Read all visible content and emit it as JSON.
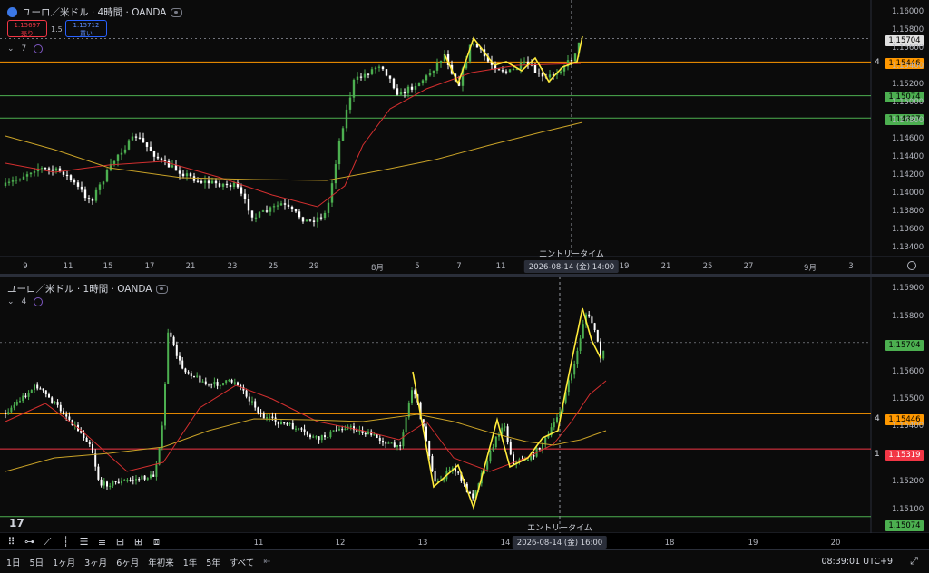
{
  "top": {
    "title": "ユーロ／米ドル · 4時間 · OANDA",
    "sell_price": "1.15697",
    "sell_label": "売り",
    "spread": "1.5",
    "buy_price": "1.15712",
    "buy_label": "買い",
    "indicator_count": "7",
    "price_axis": [
      "1.16000",
      "1.15800",
      "1.15600",
      "1.15400",
      "1.15200",
      "1.15000",
      "1.14800",
      "1.14600",
      "1.14400",
      "1.14200",
      "1.14000",
      "1.13800",
      "1.13600",
      "1.13400"
    ],
    "time_axis": [
      "9",
      "11",
      "15",
      "17",
      "21",
      "23",
      "25",
      "29",
      "8月",
      "5",
      "7",
      "11",
      "19",
      "21",
      "25",
      "27",
      "9月",
      "3"
    ],
    "crosshair_time": "2026-08-14 (金)  14:00",
    "entry_label": "エントリータイム",
    "tags": {
      "last": "1.15704",
      "orange": "1.15446",
      "green1": "1.15074",
      "green2": "1.14827"
    },
    "level_label": "4",
    "price_min": 1.133,
    "price_max": 1.1613
  },
  "bottom": {
    "title": "ユーロ／米ドル · 1時間 · OANDA",
    "indicator_count": "4",
    "price_axis": [
      "1.15900",
      "1.15800",
      "1.15600",
      "1.15500",
      "1.15400",
      "1.15200",
      "1.15100"
    ],
    "time_axis": [
      "11",
      "12",
      "13",
      "14",
      "18",
      "19",
      "20"
    ],
    "crosshair_time": "2026-08-14 (金)  16:00",
    "entry_label": "エントリータイム",
    "tags": {
      "last": "1.15704",
      "orange": "1.15446",
      "red": "1.15319",
      "green": "1.15074"
    },
    "orange_level_label": "4",
    "red_level_label": "1",
    "price_min": 1.1505,
    "price_max": 1.1593
  },
  "bottom_bar": {
    "timeframes": [
      "1日",
      "5日",
      "1ヶ月",
      "3ヶ月",
      "6ヶ月",
      "年初来",
      "1年",
      "5年",
      "すべて"
    ],
    "clock": "08:39:01 UTC+9"
  },
  "colors": {
    "up": "#4caf50",
    "down": "#ffffff",
    "ma_red": "#d32f2f",
    "ma_yellow": "#c9a227",
    "orange": "#ff9800",
    "green": "#4caf50",
    "red": "#f23645",
    "zigzag": "#ffeb3b"
  }
}
